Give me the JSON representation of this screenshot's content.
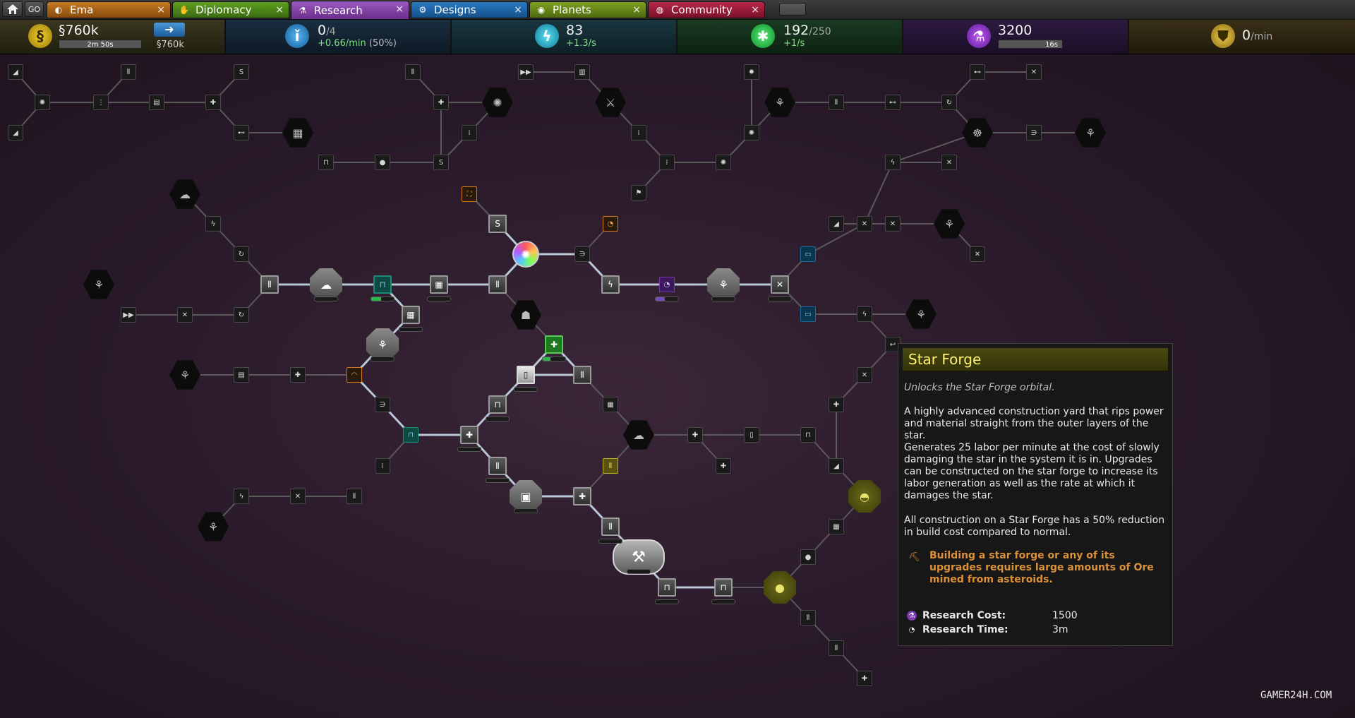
{
  "tab_bar": {
    "home_icon": "home-icon",
    "go_label": "GO",
    "tabs": [
      {
        "label": "Ema",
        "icon": "empire-icon",
        "close": "×",
        "color": "#b06a16"
      },
      {
        "label": "Diplomacy",
        "icon": "handshake-icon",
        "close": "×",
        "color": "#4c8a1a"
      },
      {
        "label": "Research",
        "icon": "research-flask-icon",
        "close": "×",
        "color": "#7a3e9e"
      },
      {
        "label": "Designs",
        "icon": "gears-icon",
        "close": "×",
        "color": "#1e6aa8"
      },
      {
        "label": "Planets",
        "icon": "planets-icon",
        "close": "×",
        "color": "#6a8a1a"
      },
      {
        "label": "Community",
        "icon": "community-icon",
        "close": "×",
        "color": "#9e1e3a"
      }
    ]
  },
  "resources": {
    "money": {
      "icon": "money-icon",
      "value": "§760k",
      "timer": "2m 50s",
      "income": "§760k",
      "budget_icon": "budget-arrow-icon"
    },
    "influence": {
      "icon": "influence-icon",
      "value": "0",
      "cap": "/4",
      "rate": "+0.66/min",
      "rate_pct": "(50%)"
    },
    "energy": {
      "icon": "energy-icon",
      "value": "83",
      "rate": "+1.3/s"
    },
    "ftl": {
      "icon": "ftl-icon",
      "value": "192",
      "cap": "/250",
      "rate": "+1/s"
    },
    "research": {
      "icon": "research-icon",
      "value": "3200",
      "timer": "16s"
    },
    "defense": {
      "icon": "defense-icon",
      "value": "0",
      "unit": "/min"
    }
  },
  "tooltip": {
    "title": "Star Forge",
    "subtitle": "Unlocks the Star Forge orbital.",
    "p1": "A highly advanced construction yard that rips power and material straight from the outer layers of the star.",
    "p2": "Generates 25 labor per minute at the cost of slowly damaging the star in the system it is in. Upgrades can be constructed on the star forge to increase its labor generation as well as the rate at which it damages the star.",
    "p3": "All construction on a Star Forge has a 50% reduction in build cost compared to normal.",
    "warning_icon": "ore-warning-icon",
    "warning": "Building a star forge or any of its upgrades requires large amounts of Ore mined from asteroids.",
    "cost_label": "Research Cost:",
    "cost_value": "1500",
    "cost_icon": "research-cost-icon",
    "time_label": "Research Time:",
    "time_value": "3m",
    "time_icon": "research-time-icon"
  },
  "watermark": "GAMER24H.COM"
}
